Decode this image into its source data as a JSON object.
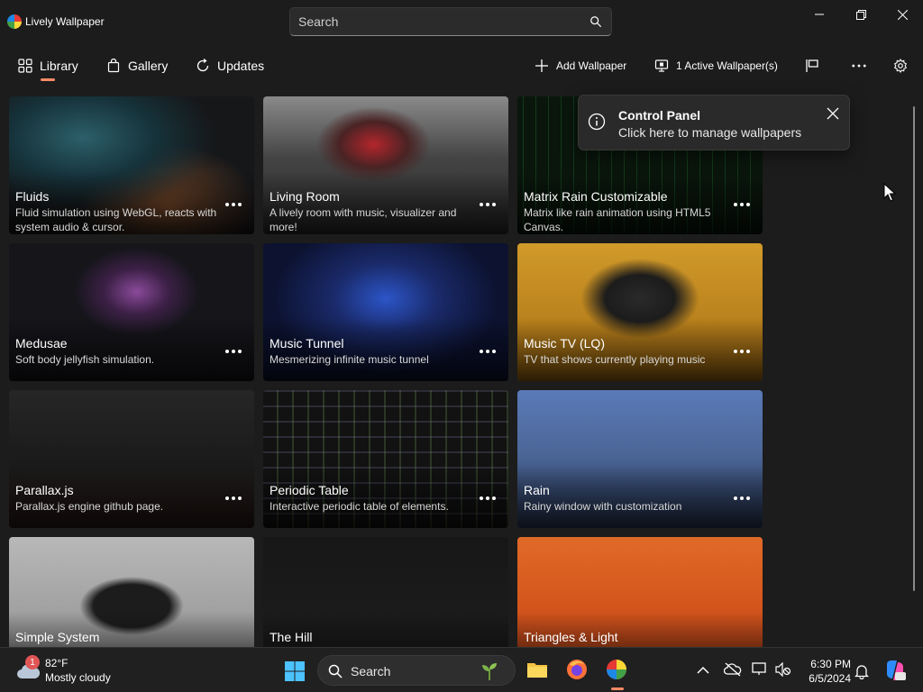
{
  "app": {
    "title": "Lively Wallpaper"
  },
  "search": {
    "placeholder": "Search"
  },
  "nav": {
    "library": "Library",
    "gallery": "Gallery",
    "updates": "Updates",
    "add_wallpaper": "Add Wallpaper",
    "active_wallpapers": "1 Active Wallpaper(s)"
  },
  "toast": {
    "title": "Control Panel",
    "message": "Click here to manage wallpapers"
  },
  "wallpapers": [
    {
      "title": "Fluids",
      "description": "Fluid simulation using WebGL, reacts with system audio & cursor."
    },
    {
      "title": "Living Room",
      "description": "A lively room with music, visualizer and more!"
    },
    {
      "title": "Matrix Rain Customizable",
      "description": "Matrix like rain animation using HTML5 Canvas."
    },
    {
      "title": "Medusae",
      "description": "Soft body jellyfish simulation."
    },
    {
      "title": "Music Tunnel",
      "description": "Mesmerizing infinite music tunnel"
    },
    {
      "title": "Music TV (LQ)",
      "description": "TV that shows currently playing music"
    },
    {
      "title": "Parallax.js",
      "description": "Parallax.js engine github page."
    },
    {
      "title": "Periodic Table",
      "description": "Interactive periodic table of elements."
    },
    {
      "title": "Rain",
      "description": "Rainy window with customization"
    },
    {
      "title": "Simple System",
      "description": ""
    },
    {
      "title": "The Hill",
      "description": ""
    },
    {
      "title": "Triangles & Light",
      "description": ""
    }
  ],
  "taskbar": {
    "weather_temp": "82°F",
    "weather_condition": "Mostly cloudy",
    "weather_badge": "1",
    "search_label": "Search",
    "time": "6:30 PM",
    "date": "6/5/2024"
  },
  "colors": {
    "accent": "#ff8a65",
    "background": "#1c1c1c",
    "taskbar": "#202020"
  }
}
